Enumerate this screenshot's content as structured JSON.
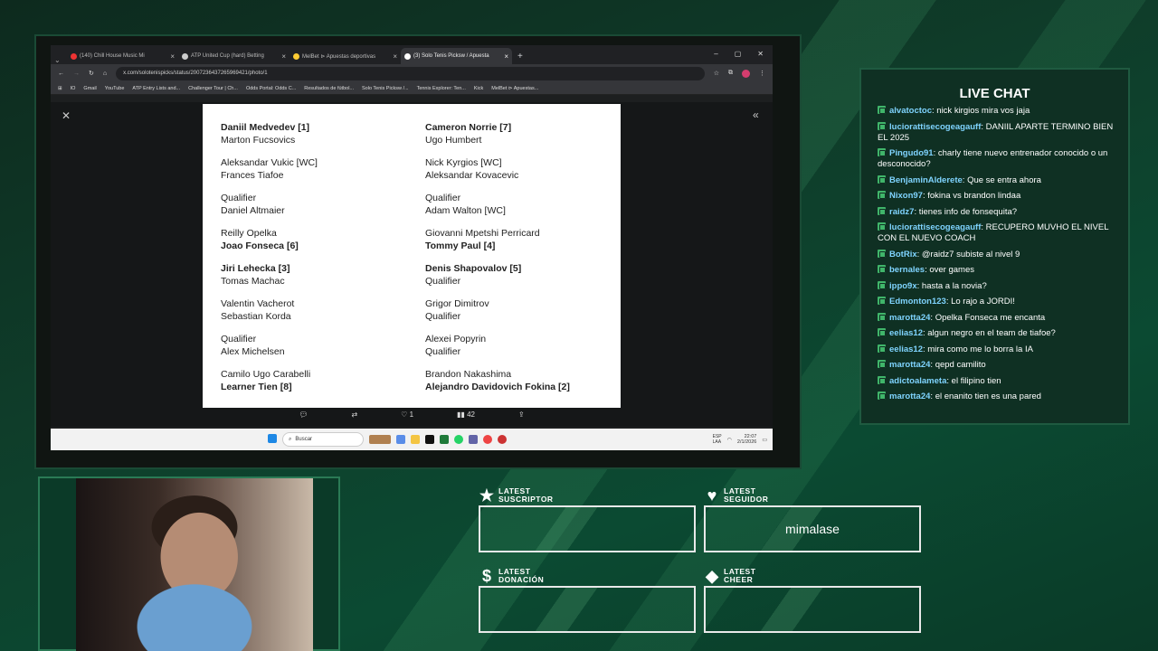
{
  "browser": {
    "tabs": [
      {
        "label": "(140) Chill House Music Mi",
        "color": "#e33"
      },
      {
        "label": "ATP United Cup (hard) Betting",
        "color": "#ccc"
      },
      {
        "label": "MelBet ⊳ Apuestas deportivas",
        "color": "#fc3"
      },
      {
        "label": "(3) Solo Tenis Picksw / Apuesta",
        "color": "#fff"
      }
    ],
    "url": "x.com/solotenispicks/status/2007236437265969421/photo/1",
    "bookmarks": [
      "IO",
      "Gmail",
      "YouTube",
      "ATP Entry Lists and...",
      "Challenger Tour | Ch...",
      "Odds Portal: Odds C...",
      "Resultados de fútbol...",
      "Solo Tenis Picksw /...",
      "Tennis Explorer: Ten...",
      "Kick",
      "MelBet ⊳ Apuestas..."
    ]
  },
  "draw": {
    "left": [
      [
        "Daniil Medvedev [1]",
        "Marton Fucsovics"
      ],
      [
        "Aleksandar Vukic  [WC]",
        "Frances Tiafoe"
      ],
      [
        "Qualifier",
        "Daniel Altmaier"
      ],
      [
        "Reilly Opelka",
        "Joao Fonseca [6]"
      ],
      [
        "Jiri Lehecka [3]",
        "Tomas Machac"
      ],
      [
        "Valentin Vacherot",
        "Sebastian Korda"
      ],
      [
        "Qualifier",
        "Alex Michelsen"
      ],
      [
        "Camilo Ugo Carabelli",
        "Learner Tien [8]"
      ]
    ],
    "right": [
      [
        "Cameron Norrie [7]",
        "Ugo Humbert"
      ],
      [
        "Nick Kyrgios  [WC]",
        "Aleksandar Kovacevic"
      ],
      [
        "Qualifier",
        "Adam Walton  [WC]"
      ],
      [
        "Giovanni Mpetshi Perricard",
        "Tommy Paul [4]"
      ],
      [
        "Denis Shapovalov [5]",
        "Qualifier"
      ],
      [
        "Grigor Dimitrov",
        "Qualifier"
      ],
      [
        "Alexei Popyrin",
        "Qualifier"
      ],
      [
        "Brandon Nakashima",
        "Alejandro Davidovich Fokina [2]"
      ]
    ],
    "bold": [
      "Daniil Medvedev [1]",
      "Joao Fonseca [6]",
      "Jiri Lehecka [3]",
      "Learner Tien [8]",
      "Cameron Norrie [7]",
      "Tommy Paul [4]",
      "Denis Shapovalov [5]",
      "Alejandro Davidovich Fokina [2]"
    ]
  },
  "post_actions": {
    "likes": "1",
    "views": "42"
  },
  "taskbar": {
    "search": "Buscar",
    "lang": "ESP\nLAA",
    "time": "22:07",
    "date": "2/1/2026"
  },
  "chat": {
    "title": "LIVE CHAT",
    "messages": [
      {
        "user": "alvatoctoc",
        "text": "nick kirgios mira vos jaja"
      },
      {
        "user": "luciorattisecogeagauff",
        "text": "DANIIL APARTE TERMINO BIEN EL 2025"
      },
      {
        "user": "Pingudo91",
        "text": "charly tiene nuevo entrenador conocido o un desconocido?"
      },
      {
        "user": "BenjaminAlderete",
        "text": "Que se entra ahora"
      },
      {
        "user": "Nixon97",
        "text": "fokina vs brandon lindaa"
      },
      {
        "user": "raidz7",
        "text": "tienes info de fonsequita?"
      },
      {
        "user": "luciorattisecogeagauff",
        "text": "RECUPERO MUVHO EL NIVEL CON EL NUEVO COACH"
      },
      {
        "user": "BotRix",
        "text": "@raidz7 subiste al nivel 9"
      },
      {
        "user": "bernales",
        "text": "over games"
      },
      {
        "user": "ippo9x",
        "text": "hasta a la novia?"
      },
      {
        "user": "Edmonton123",
        "text": "Lo rajo a JORDI!"
      },
      {
        "user": "marotta24",
        "text": "Opelka Fonseca me encanta"
      },
      {
        "user": "eelias12",
        "text": "algun negro en el team de tiafoe?"
      },
      {
        "user": "eelias12",
        "text": "mira como me lo borra la IA"
      },
      {
        "user": "marotta24",
        "text": "qepd camilito"
      },
      {
        "user": "adictoalameta",
        "text": "el filipino tien"
      },
      {
        "user": "marotta24",
        "text": "el enanito tien es una pared"
      }
    ]
  },
  "alerts": {
    "suscriptor": {
      "label1": "LATEST",
      "label2": "SUSCRIPTOR",
      "value": ""
    },
    "seguidor": {
      "label1": "LATEST",
      "label2": "SEGUIDOR",
      "value": "mimalase"
    },
    "donacion": {
      "label1": "LATEST",
      "label2": "DONACIÓN",
      "value": ""
    },
    "cheer": {
      "label1": "LATEST",
      "label2": "CHEER",
      "value": ""
    }
  }
}
